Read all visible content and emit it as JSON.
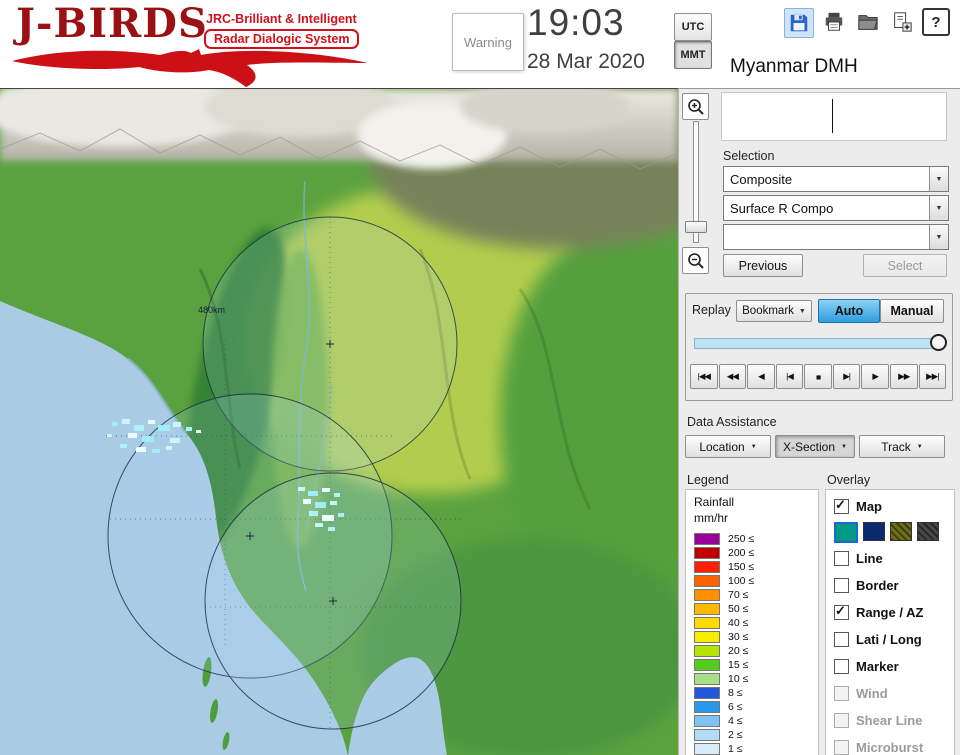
{
  "header": {
    "logo": {
      "title": "J-BIRDS",
      "subtitle1": "JRC-Brilliant & Intelligent",
      "subtitle2": "Radar  Dialogic  System"
    },
    "warning_button": "Warning",
    "clock": {
      "time": "19:03",
      "date": "28 Mar 2020"
    },
    "timezone": {
      "utc": "UTC",
      "mmt": "MMT",
      "selected": "MMT"
    },
    "org_name": "Myanmar DMH",
    "help_glyph": "?"
  },
  "display_box": {
    "value": ""
  },
  "selection": {
    "label": "Selection",
    "composite_value": "Composite",
    "product_value": "Surface R Compo",
    "extra_value": "",
    "previous_button": "Previous",
    "select_button": "Select",
    "select_enabled": false
  },
  "replay": {
    "label": "Replay",
    "bookmark_button": "Bookmark",
    "auto_button": "Auto",
    "manual_button": "Manual",
    "mode_selected": "Auto",
    "slider_position_pct": 100,
    "playback": [
      "|◀◀",
      "◀◀",
      "◀",
      "|◀",
      "■",
      "▶|",
      "▶",
      "▶▶",
      "▶▶|"
    ]
  },
  "data_assistance": {
    "label": "Data Assistance",
    "location_button": "Location",
    "xsection_button": "X-Section",
    "track_button": "Track"
  },
  "legend": {
    "label": "Legend",
    "title1": "Rainfall",
    "title2": "mm/hr",
    "entries": [
      {
        "value": "250 ≤",
        "color": "#990099"
      },
      {
        "value": "200 ≤",
        "color": "#c00000"
      },
      {
        "value": "150 ≤",
        "color": "#ff2000"
      },
      {
        "value": "100 ≤",
        "color": "#ff6000"
      },
      {
        "value": "70 ≤",
        "color": "#ff9000"
      },
      {
        "value": "50 ≤",
        "color": "#ffb800"
      },
      {
        "value": "40 ≤",
        "color": "#ffdc00"
      },
      {
        "value": "30 ≤",
        "color": "#f4f000"
      },
      {
        "value": "20 ≤",
        "color": "#b4e400"
      },
      {
        "value": "15 ≤",
        "color": "#54cc1c"
      },
      {
        "value": "10 ≤",
        "color": "#a8e088"
      },
      {
        "value": "8 ≤",
        "color": "#2058dc"
      },
      {
        "value": "6 ≤",
        "color": "#2898ec"
      },
      {
        "value": "4 ≤",
        "color": "#7cc4f4"
      },
      {
        "value": "2 ≤",
        "color": "#b4dcf8"
      },
      {
        "value": "1 ≤",
        "color": "#d8ecfc"
      }
    ]
  },
  "overlay": {
    "label": "Overlay",
    "items": [
      {
        "label": "Map",
        "checked": true,
        "disabled": false
      },
      {
        "label": "Line",
        "checked": false,
        "disabled": false
      },
      {
        "label": "Border",
        "checked": false,
        "disabled": false
      },
      {
        "label": "Range / AZ",
        "checked": true,
        "disabled": false
      },
      {
        "label": "Lati / Long",
        "checked": false,
        "disabled": false
      },
      {
        "label": "Marker",
        "checked": false,
        "disabled": false
      },
      {
        "label": "Wind",
        "checked": false,
        "disabled": true
      },
      {
        "label": "Shear Line",
        "checked": false,
        "disabled": true
      },
      {
        "label": "Microburst",
        "checked": false,
        "disabled": true
      }
    ],
    "map_swatches": {
      "colors": [
        "#009a86",
        "#0c2a6e",
        "#6e6e14",
        "#464646"
      ],
      "selected_index": 0
    }
  },
  "map": {
    "range_ring_label": "480km"
  }
}
